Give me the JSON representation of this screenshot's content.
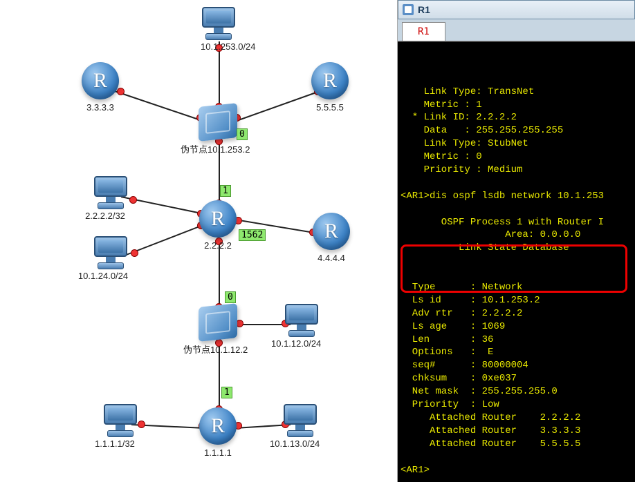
{
  "window": {
    "title": "R1",
    "tab_label": "R1"
  },
  "terminal": {
    "lines": [
      "    Link Type: TransNet",
      "    Metric : 1",
      "  * Link ID: 2.2.2.2",
      "    Data   : 255.255.255.255",
      "    Link Type: StubNet",
      "    Metric : 0",
      "    Priority : Medium",
      "",
      "<AR1>dis ospf lsdb network 10.1.253",
      "",
      "       OSPF Process 1 with Router I",
      "                  Area: 0.0.0.0",
      "          Link State Database",
      "",
      "",
      "  Type      : Network",
      "  Ls id     : 10.1.253.2",
      "  Adv rtr   : 2.2.2.2",
      "  Ls age    : 1069",
      "  Len       : 36",
      "  Options   :  E",
      "  seq#      : 80000004",
      "  chksum    : 0xe037",
      "  Net mask  : 255.255.255.0",
      "  Priority  : Low",
      "     Attached Router    2.2.2.2",
      "     Attached Router    3.3.3.3",
      "     Attached Router    5.5.5.5",
      "",
      "<AR1>"
    ]
  },
  "topology": {
    "routers": {
      "r3": {
        "glyph": "R",
        "label": "3.3.3.3"
      },
      "r5": {
        "glyph": "R",
        "label": "5.5.5.5"
      },
      "r2": {
        "glyph": "R",
        "label": "2.2.2.2"
      },
      "r4": {
        "glyph": "R",
        "label": "4.4.4.4"
      },
      "r1": {
        "glyph": "R",
        "label": "1.1.1.1"
      }
    },
    "hosts": {
      "h_top": {
        "label": "10.1.253.0/24"
      },
      "h_222": {
        "label": "2.2.2.2/32"
      },
      "h_1024": {
        "label": "10.1.24.0/24"
      },
      "h_1012": {
        "label": "10.1.12.0/24"
      },
      "h_111": {
        "label": "1.1.1.1/32"
      },
      "h_1013": {
        "label": "10.1.13.0/24"
      }
    },
    "switches": {
      "sw253": {
        "label": "伪节点10.1.253.2"
      },
      "sw12": {
        "label": "伪节点10.1.12.2"
      }
    },
    "badges": {
      "b0a": "0",
      "b1a": "1",
      "b1562": "1562",
      "b0b": "0",
      "b1b": "1"
    }
  }
}
